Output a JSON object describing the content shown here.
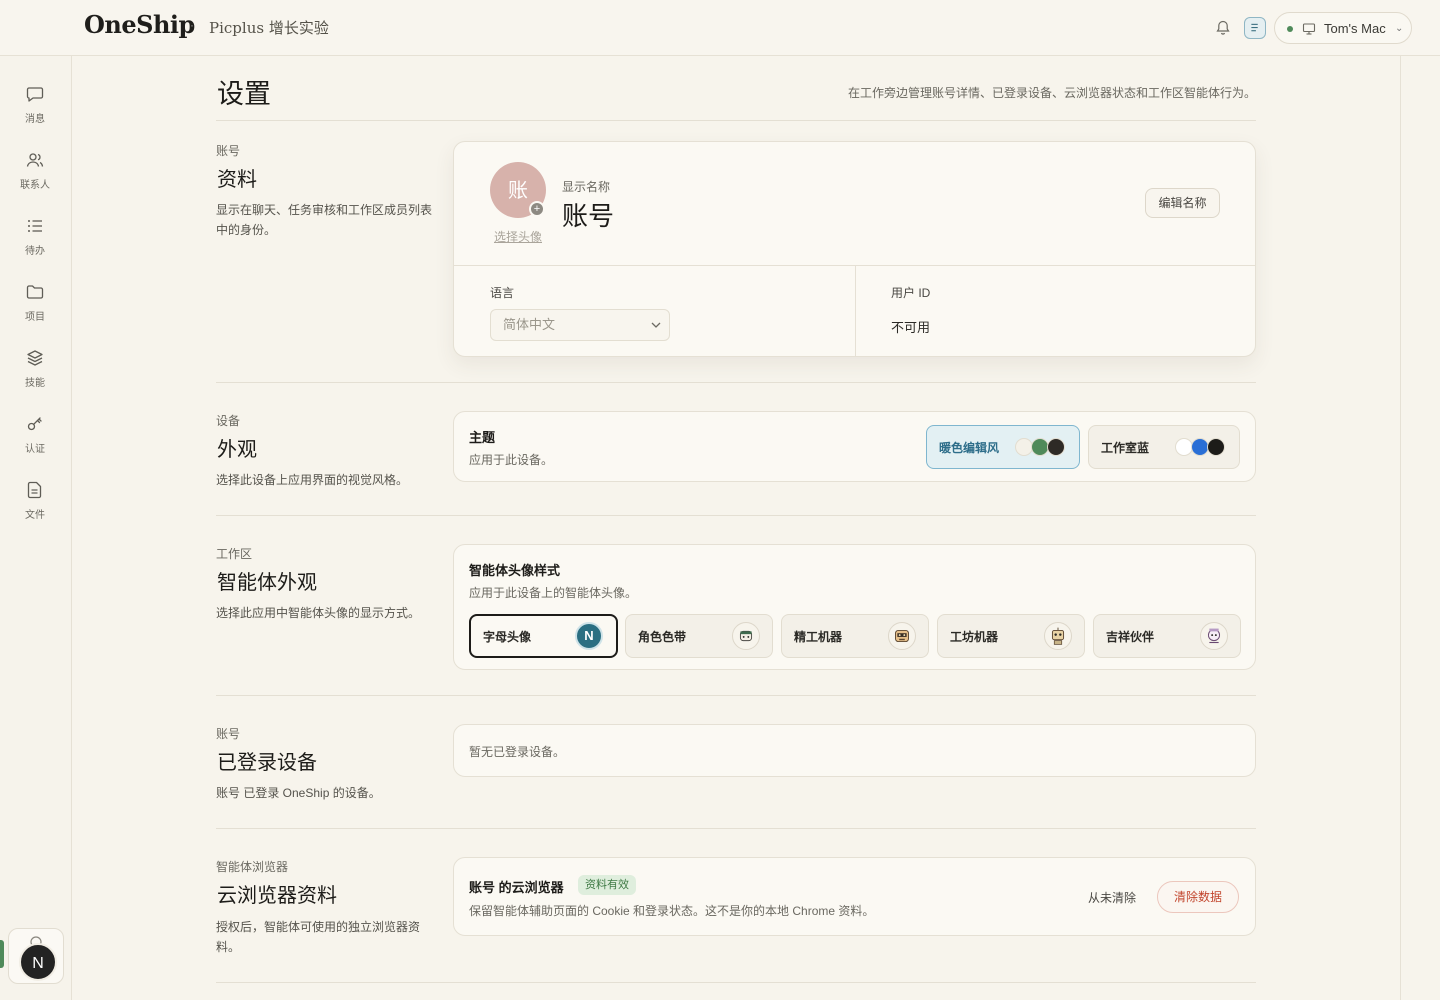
{
  "topbar": {
    "brand": "OneShip",
    "separator": "·",
    "workspace": "Picplus 增长实验",
    "machine": "Tom's Mac",
    "bell_icon": "bell-icon",
    "doc_icon": "document-icon",
    "status_color": "#4f8a5a"
  },
  "rail": {
    "items": [
      {
        "label": "消息",
        "icon": "chat-icon"
      },
      {
        "label": "联系人",
        "icon": "contacts-icon"
      },
      {
        "label": "待办",
        "icon": "todo-list-icon"
      },
      {
        "label": "项目",
        "icon": "folder-icon"
      },
      {
        "label": "技能",
        "icon": "layers-icon"
      },
      {
        "label": "认证",
        "icon": "key-icon"
      },
      {
        "label": "文件",
        "icon": "file-icon"
      }
    ],
    "user_initial": "N"
  },
  "page": {
    "title": "设置",
    "description": "在工作旁边管理账号详情、已登录设备、云浏览器状态和工作区智能体行为。"
  },
  "sections": {
    "profile": {
      "eyebrow": "账号",
      "title": "资料",
      "description": "显示在聊天、任务审核和工作区成员列表中的身份。",
      "avatar_char": "账",
      "avatar_color": "#d7b2ab",
      "choose_avatar": "选择头像",
      "display_name_label": "显示名称",
      "display_name": "账号",
      "edit_name": "编辑名称",
      "language_label": "语言",
      "language_value": "简体中文",
      "user_id_label": "用户 ID",
      "user_id_value": "不可用"
    },
    "appearance": {
      "eyebrow": "设备",
      "title": "外观",
      "description": "选择此设备上应用界面的视觉风格。",
      "theme_label": "主题",
      "theme_desc": "应用于此设备。",
      "themes": [
        {
          "label": "暖色编辑风",
          "active": true,
          "swatches": [
            "#f4f1e8",
            "#4f8a5a",
            "#2e2a26"
          ]
        },
        {
          "label": "工作室蓝",
          "active": false,
          "swatches": [
            "#ffffff",
            "#2a6fd6",
            "#1d1c19"
          ]
        }
      ]
    },
    "agent_appearance": {
      "eyebrow": "工作区",
      "title": "智能体外观",
      "description": "选择此应用中智能体头像的显示方式。",
      "style_label": "智能体头像样式",
      "style_desc": "应用于此设备上的智能体头像。",
      "options": [
        {
          "label": "字母头像",
          "active": true,
          "icon": "letter-avatar-icon",
          "letter": "N"
        },
        {
          "label": "角色色带",
          "active": false,
          "icon": "role-band-avatar-icon"
        },
        {
          "label": "精工机器",
          "active": false,
          "icon": "crafted-robot-avatar-icon"
        },
        {
          "label": "工坊机器",
          "active": false,
          "icon": "workshop-robot-avatar-icon"
        },
        {
          "label": "吉祥伙伴",
          "active": false,
          "icon": "mascot-avatar-icon"
        }
      ]
    },
    "devices": {
      "eyebrow": "账号",
      "title": "已登录设备",
      "description": "账号 已登录 OneShip 的设备。",
      "empty": "暂无已登录设备。"
    },
    "browser": {
      "eyebrow": "智能体浏览器",
      "title": "云浏览器资料",
      "description": "授权后，智能体可使用的独立浏览器资料。",
      "card_title": "账号 的云浏览器",
      "badge": "资料有效",
      "card_desc": "保留智能体辅助页面的 Cookie 和登录状态。这不是你的本地 Chrome 资料。",
      "never_cleared": "从未清除",
      "clear_button": "清除数据",
      "danger_color": "#c2452d"
    }
  }
}
